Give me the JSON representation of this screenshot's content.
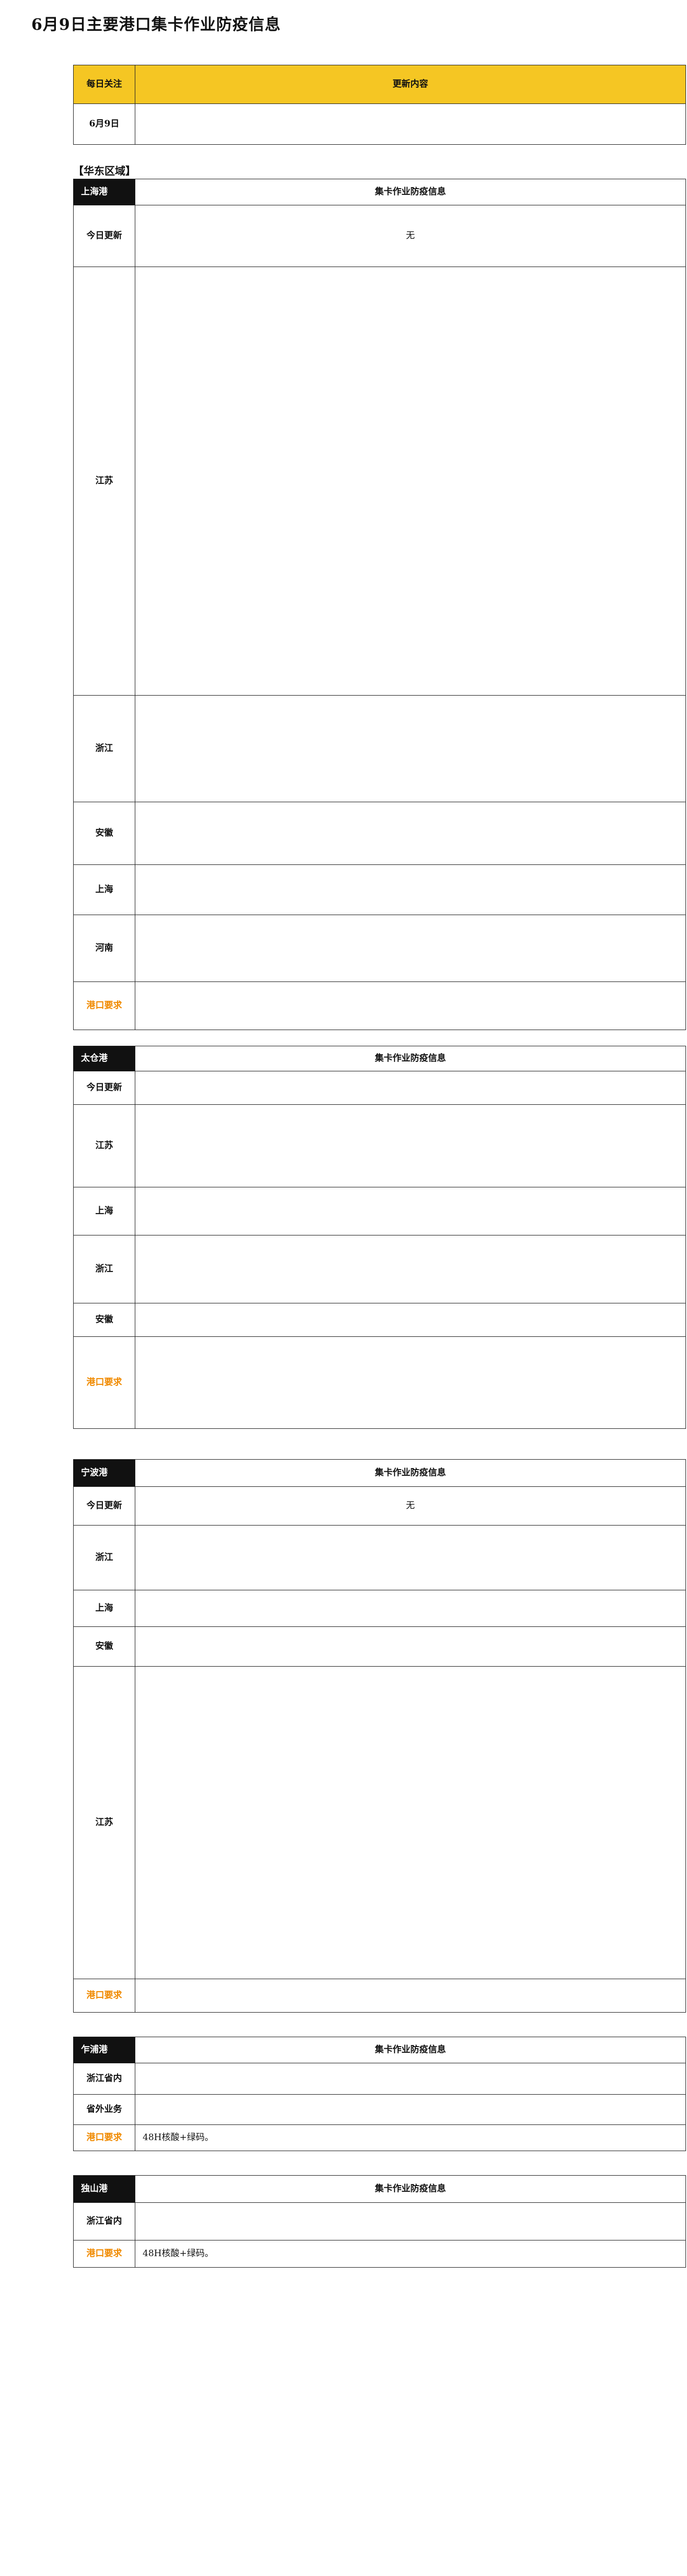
{
  "document": {
    "title": "6月9日主要港口集卡作业防疫信息"
  },
  "summary": {
    "col_focus": "每日关注",
    "col_update": "更新内容",
    "date": "6月9日",
    "text": ""
  },
  "region_east": "【华东区域】",
  "shanghai": {
    "port": "上海港",
    "header": "集卡作业防疫信息",
    "today_label": "今日更新",
    "today_value": "无",
    "jiangsu": {
      "label": "江苏",
      "text_a": "",
      "text_b": ""
    },
    "zhejiang": {
      "label": "浙江",
      "text": ""
    },
    "anhui": {
      "label": "安徽",
      "text": ""
    },
    "shanghai": {
      "label": "上海",
      "text": ""
    },
    "henan": {
      "label": "河南",
      "text": ""
    },
    "requirement": {
      "label": "港口要求",
      "text": ""
    }
  },
  "taicang": {
    "port": "太仓港",
    "header": "集卡作业防疫信息",
    "today_label": "今日更新",
    "today_value": "",
    "jiangsu": {
      "label": "江苏",
      "text": ""
    },
    "shanghai": {
      "label": "上海",
      "text": ""
    },
    "zhejiang": {
      "label": "浙江",
      "text": ""
    },
    "anhui": {
      "label": "安徽",
      "text": ""
    },
    "requirement": {
      "label": "港口要求",
      "text": ""
    }
  },
  "ningbo": {
    "port": "宁波港",
    "header": "集卡作业防疫信息",
    "today_label": "今日更新",
    "today_value": "无",
    "zhejiang": {
      "label": "浙江",
      "text": ""
    },
    "shanghai": {
      "label": "上海",
      "text": ""
    },
    "anhui": {
      "label": "安徽",
      "text": ""
    },
    "jiangsu": {
      "label": "江苏",
      "text": ""
    },
    "requirement": {
      "label": "港口要求",
      "text": ""
    }
  },
  "zhapu": {
    "port": "乍浦港",
    "header": "集卡作业防疫信息",
    "in_province": {
      "label": "浙江省内",
      "text": ""
    },
    "out_province": {
      "label": "省外业务",
      "text": ""
    },
    "requirement": {
      "label": "港口要求",
      "text": "48H核酸+绿码。"
    }
  },
  "zhoushan": {
    "port": "独山港",
    "header": "集卡作业防疫信息",
    "in_province": {
      "label": "浙江省内",
      "text": ""
    },
    "requirement": {
      "label": "港口要求",
      "text": "48H核酸+绿码。"
    }
  }
}
